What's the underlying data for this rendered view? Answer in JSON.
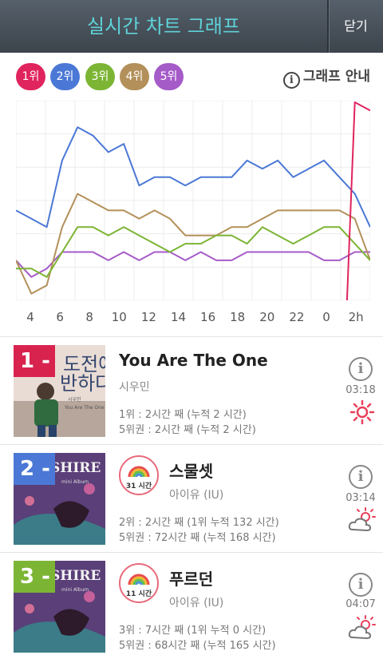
{
  "header": {
    "title": "실시간 차트 그래프",
    "close_label": "닫기"
  },
  "legend": [
    {
      "label": "1위",
      "color": "#e0245e"
    },
    {
      "label": "2위",
      "color": "#4b78d6"
    },
    {
      "label": "3위",
      "color": "#7cb534"
    },
    {
      "label": "4위",
      "color": "#b3905a"
    },
    {
      "label": "5위",
      "color": "#a55bc8"
    }
  ],
  "guide_label": "그래프 안내",
  "chart_data": {
    "type": "line",
    "x": [
      "3",
      "4",
      "5",
      "6",
      "7",
      "8",
      "9",
      "10",
      "11",
      "12",
      "13",
      "14",
      "15",
      "16",
      "17",
      "18",
      "19",
      "20",
      "21",
      "22",
      "23",
      "0",
      "1",
      "2h"
    ],
    "tick_labels": [
      "4",
      "6",
      "8",
      "10",
      "12",
      "14",
      "16",
      "18",
      "20",
      "22",
      "0",
      "2h"
    ],
    "y_direction": "rank, lower is better (top of chart = rank 1)",
    "series": [
      {
        "name": "1위",
        "values": [
          null,
          null,
          null,
          null,
          null,
          null,
          null,
          null,
          null,
          null,
          null,
          null,
          null,
          null,
          null,
          null,
          null,
          null,
          null,
          null,
          null,
          null,
          1,
          2
        ]
      },
      {
        "name": "2위",
        "values": [
          14,
          15,
          16,
          8,
          4,
          5,
          7,
          6,
          11,
          10,
          10,
          11,
          10,
          10,
          10,
          8,
          9,
          8,
          10,
          9,
          8,
          10,
          12,
          16
        ]
      },
      {
        "name": "3위",
        "values": [
          21,
          21,
          22,
          19,
          16,
          16,
          17,
          16,
          17,
          18,
          19,
          18,
          18,
          17,
          17,
          18,
          16,
          17,
          18,
          17,
          16,
          16,
          18,
          20
        ]
      },
      {
        "name": "4위",
        "values": [
          20,
          24,
          23,
          16,
          12,
          13,
          14,
          14,
          15,
          14,
          15,
          17,
          17,
          17,
          16,
          16,
          15,
          14,
          14,
          14,
          14,
          14,
          15,
          20
        ]
      },
      {
        "name": "5위",
        "values": [
          20,
          22,
          21,
          19,
          19,
          19,
          20,
          19,
          20,
          19,
          19,
          20,
          19,
          20,
          20,
          19,
          19,
          19,
          19,
          19,
          20,
          20,
          19,
          19
        ]
      }
    ]
  },
  "songs": [
    {
      "rank": "1",
      "title": "You Are The One",
      "artist": "시우민",
      "stat1": "1위 : 2시간 째 (누적 2 시간)",
      "stat2": "5위권 : 2시간 째 (누적 2 시간)",
      "time": "03:18",
      "weather": "sunny-icon",
      "rank_color": "#d8234f",
      "cover_text": [
        "도전에",
        "반하다"
      ],
      "cover_small": [
        "시우민",
        "You Are The One"
      ]
    },
    {
      "rank": "2",
      "title": "스물셋",
      "artist": "아이유 (IU)",
      "badge": "31 시간",
      "stat1": "2위 : 2시간 째 (1위 누적 132 시간)",
      "stat2": "5위권 : 72시간 째 (누적 168 시간)",
      "time": "03:14",
      "weather": "partly-cloudy-icon",
      "rank_color": "#4b78d6",
      "cover_text": [
        "SHIRE"
      ],
      "cover_small": [
        "mini Album"
      ]
    },
    {
      "rank": "3",
      "title": "푸르던",
      "artist": "아이유 (IU)",
      "badge": "11 시간",
      "stat1": "3위 : 7시간 째 (1위 누적 0 시간)",
      "stat2": "5위권 : 68시간 째 (누적 165 시간)",
      "time": "04:07",
      "weather": "partly-cloudy-icon",
      "rank_color": "#7cb534",
      "cover_text": [
        "SHIRE"
      ],
      "cover_small": [
        "mini Album"
      ]
    }
  ]
}
